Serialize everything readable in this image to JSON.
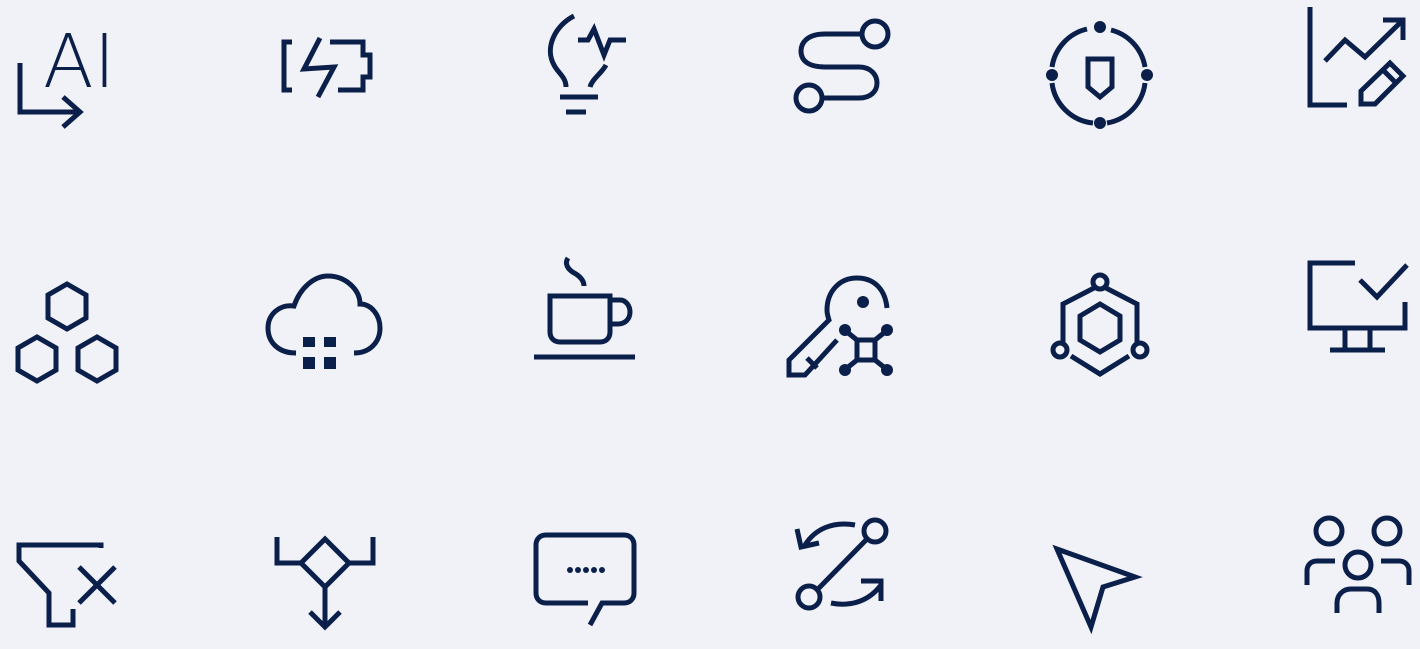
{
  "theme": {
    "background": "#f1f2f7",
    "icon_color": "#0b1f4b"
  },
  "icons": {
    "ai": {
      "name": "ai-label-icon",
      "text": "AI"
    },
    "energy": {
      "name": "battery-charging-icon"
    },
    "bulb": {
      "name": "lightbulb-pulse-icon"
    },
    "route": {
      "name": "route-path-icon"
    },
    "shield": {
      "name": "shield-cycle-icon"
    },
    "chart_edit": {
      "name": "chart-edit-icon"
    },
    "hexagons": {
      "name": "hexagon-cluster-icon"
    },
    "cloud_app": {
      "name": "cloud-app-icon"
    },
    "cafe": {
      "name": "coffee-cup-icon"
    },
    "key_network": {
      "name": "key-network-icon"
    },
    "hex_orbit": {
      "name": "hexagon-orbit-icon"
    },
    "monitor_check": {
      "name": "monitor-check-icon"
    },
    "filter_remove": {
      "name": "filter-remove-icon"
    },
    "decision": {
      "name": "decision-flow-icon"
    },
    "chat": {
      "name": "chat-ellipsis-icon"
    },
    "migrate": {
      "name": "migrate-icon"
    },
    "cursor": {
      "name": "cursor-pointer-icon"
    },
    "group": {
      "name": "user-group-icon"
    }
  }
}
